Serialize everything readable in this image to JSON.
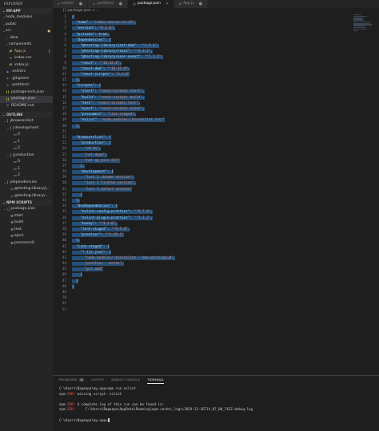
{
  "explorer": {
    "title": "EXPLORER",
    "section": "MY-APP",
    "tree": [
      {
        "label": "node_modules",
        "depth": 1,
        "type": "folder",
        "state": "closed"
      },
      {
        "label": "public",
        "depth": 1,
        "type": "folder",
        "state": "closed"
      },
      {
        "label": "src",
        "depth": 1,
        "type": "folder",
        "state": "open",
        "err": true,
        "badge": "●"
      },
      {
        "label": ".idea",
        "depth": 2,
        "type": "folder",
        "state": "closed"
      },
      {
        "label": "components",
        "depth": 2,
        "type": "folder",
        "state": "closed"
      },
      {
        "label": "App.js",
        "depth": 2,
        "type": "js",
        "err": true,
        "badge": "1"
      },
      {
        "label": "index.css",
        "depth": 2,
        "type": "css"
      },
      {
        "label": "index.js",
        "depth": 2,
        "type": "js"
      },
      {
        "label": ".eslintrc",
        "depth": 1,
        "type": "eslint"
      },
      {
        "label": ".gitignore",
        "depth": 1,
        "type": "git"
      },
      {
        "label": ".prettierrc",
        "depth": 1,
        "type": "prettier"
      },
      {
        "label": "package-lock.json",
        "depth": 1,
        "type": "json"
      },
      {
        "label": "package.json",
        "depth": 1,
        "type": "json",
        "selected": true
      },
      {
        "label": "README.md",
        "depth": 1,
        "type": "md"
      }
    ]
  },
  "outline": {
    "title": "OUTLINE",
    "items": [
      {
        "label": "browserslist",
        "depth": 1,
        "icon": "{ }"
      },
      {
        "label": "development",
        "depth": 2,
        "icon": "[ ]"
      },
      {
        "label": "0",
        "depth": 3,
        "icon": "▭"
      },
      {
        "label": "1",
        "depth": 3,
        "icon": "▭"
      },
      {
        "label": "2",
        "depth": 3,
        "icon": "▭"
      },
      {
        "label": "production",
        "depth": 2,
        "icon": "[ ]"
      },
      {
        "label": "0",
        "depth": 3,
        "icon": "▭"
      },
      {
        "label": "1",
        "depth": 3,
        "icon": "▭"
      },
      {
        "label": "2",
        "depth": 3,
        "icon": "▭"
      },
      {
        "label": "dependencies",
        "depth": 1,
        "icon": "{ }"
      },
      {
        "label": "@testing-library/j...",
        "depth": 2,
        "icon": "▭"
      },
      {
        "label": "@testing-library/...",
        "depth": 2,
        "icon": "▭"
      }
    ]
  },
  "npm_scripts": {
    "title": "NPM SCRIPTS",
    "file": "package.json",
    "scripts": [
      "start",
      "build",
      "test",
      "eject",
      "precommit"
    ]
  },
  "tabs": [
    {
      "label": "eslintrc",
      "active": false
    },
    {
      "label": ".prettierrc",
      "active": false
    },
    {
      "label": "package.json",
      "active": true
    },
    {
      "label": "App.js",
      "active": false
    }
  ],
  "breadcrumb": "{} package.json > ...",
  "editor": {
    "line_numbers": [
      "1",
      "2",
      "3",
      "4",
      "5",
      "6",
      "7",
      "8",
      "9",
      "10",
      "11",
      "12",
      "13",
      "14",
      "15",
      "16",
      "17",
      "18",
      "19",
      "20",
      "21",
      "22",
      "23",
      "24",
      "25",
      "26",
      "27",
      "28",
      "29",
      "30",
      "31",
      "32",
      "33",
      "34",
      "35",
      "36",
      "37",
      "38",
      "39",
      "40",
      "41",
      "42",
      "43",
      "44",
      "45",
      "46",
      "47",
      "48",
      "49",
      "50",
      "51",
      "52"
    ],
    "lines": [
      "{",
      "  \"name\": \"redux-course-ru-v2\",",
      "  \"version\": \"0.1.0\",",
      "  \"private\": true,",
      "  \"dependencies\": {",
      "    \"@testing-library/jest-dom\": \"^4.2.4\",",
      "    \"@testing-library/react\": \"^9.3.2\",",
      "    \"@testing-library/user-event\": \"^7.1.2\",",
      "    \"react\": \"^16.12.0\",",
      "    \"react-dom\": \"^16.12.0\",",
      "    \"react-scripts\": \"3.3.0\"",
      "  },",
      "  \"scripts\": {",
      "    \"start\": \"react-scripts start\",",
      "    \"build\": \"react-scripts build\",",
      "    \"test\": \"react-scripts test\",",
      "    \"eject\": \"react-scripts eject\",",
      "    \"precommit\": \"lint-staged\",",
      "    \"eslint\": \"node_modules/.bin/eslint src/\"",
      "  },",
      "",
      "  \"browserslist\": {",
      "    \"production\": [",
      "      \">0.2%\",",
      "      \"not dead\",",
      "      \"not op_mini all\"",
      "    ],",
      "    \"development\": [",
      "      \"last 1 chrome version\",",
      "      \"last 1 firefox version\",",
      "      \"last 1 safari version\"",
      "    ]",
      "  },",
      "  \"devDependencies\": {",
      "    \"eslint-config-prettier\": \"^6.7.0\",",
      "    \"eslint-plugin-prettier\": \"^3.1.2\",",
      "    \"husky\": \"^3.1.0\",",
      "    \"lint-staged\": \"^9.5.0\",",
      "    \"prettier\": \"^1.19.1\"",
      "  },",
      "  \"lint-staged\": {",
      "    \"*.{js,jsx}\": [",
      "      \"node_modules/.bin/eslint --max-warnings=0\",",
      "      \"prettier --write\",",
      "      \"git add\"",
      "    ]",
      "  }",
      "}",
      "",
      "",
      "",
      ""
    ]
  },
  "panel": {
    "tabs": [
      "PROBLEMS",
      "OUTPUT",
      "DEBUG CONSOLE",
      "TERMINAL"
    ],
    "active_tab": "TERMINAL",
    "problems_count": "1",
    "terminal": [
      {
        "text": "C:\\Users\\Варвара\\my-app>npm run eslint",
        "err": false
      },
      {
        "text": "npm ERR! missing script: eslint",
        "err": true
      },
      {
        "text": "",
        "err": false
      },
      {
        "text": "npm ERR! A complete log of this run can be found in:",
        "err": true
      },
      {
        "text": "npm ERR!     C:\\Users\\Варвара\\AppData\\Roaming\\npm-cache\\_logs\\2019-12-16T14_07_00_742Z-debug.log",
        "err": true
      },
      {
        "text": "",
        "err": false
      },
      {
        "text": "C:\\Users\\Варвара\\my-app>",
        "err": false,
        "cursor": true
      }
    ]
  }
}
